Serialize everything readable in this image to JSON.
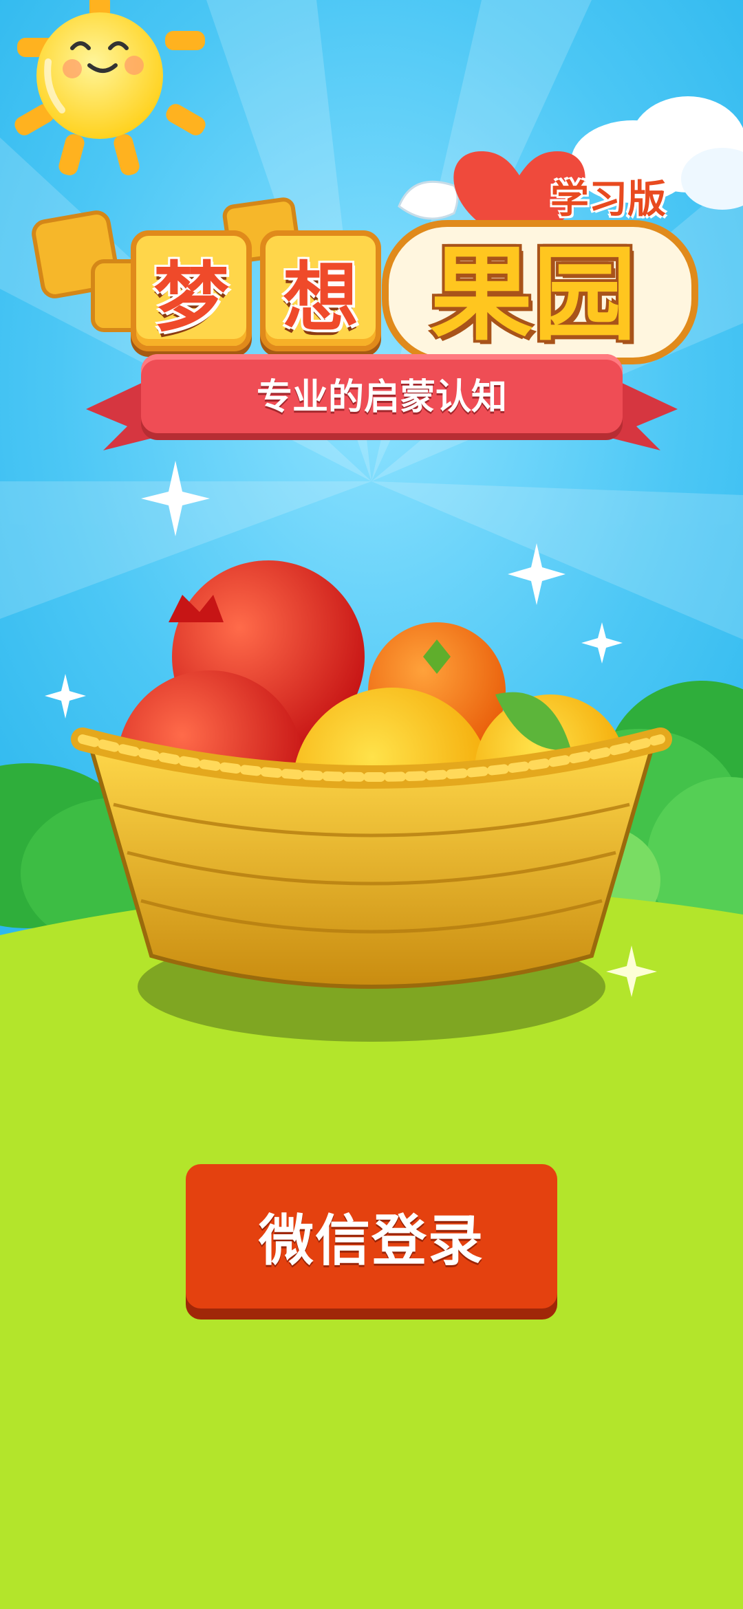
{
  "app": {
    "title_chars": [
      "梦",
      "想"
    ],
    "title_right": "果园",
    "edition_label": "学习版",
    "tagline": "专业的启蒙认知"
  },
  "actions": {
    "login_label": "微信登录"
  },
  "colors": {
    "sky": "#4cc7f5",
    "grass": "#b3e52b",
    "button": "#e4410f",
    "ribbon": "#ef4d55",
    "tile": "#ffd64a"
  },
  "icons": [
    "sun-icon",
    "cloud-icon",
    "heart-wing-icon",
    "sparkle-icon",
    "fruit-basket-illustration"
  ]
}
